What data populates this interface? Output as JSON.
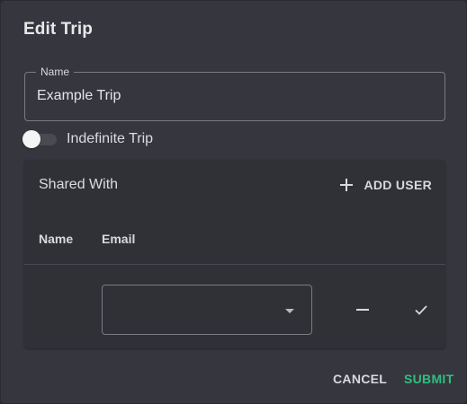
{
  "dialog": {
    "title": "Edit Trip"
  },
  "name_field": {
    "label": "Name",
    "value": "Example Trip"
  },
  "indefinite_toggle": {
    "label": "Indefinite Trip",
    "checked": false
  },
  "shared_with": {
    "title": "Shared With",
    "add_user_label": "ADD USER",
    "columns": [
      "Name",
      "Email"
    ],
    "rows": [
      {
        "name": "",
        "email": ""
      }
    ]
  },
  "actions": {
    "cancel_label": "CANCEL",
    "submit_label": "SUBMIT"
  },
  "colors": {
    "accent": "#2fbf80",
    "surface": "#36373e",
    "panel": "#303137"
  },
  "icons": {
    "add": "plus-icon",
    "dropdown": "caret-down-icon",
    "remove": "minus-icon",
    "confirm": "check-icon"
  }
}
